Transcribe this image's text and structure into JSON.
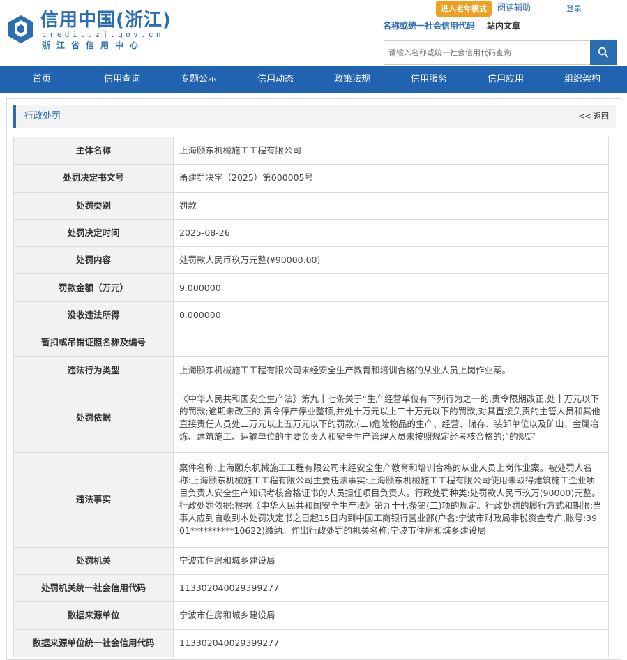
{
  "site": {
    "name": "信用中国(浙江)",
    "domain": "credit.zj.gov.cn",
    "center": "浙江省信用中心"
  },
  "topbar": {
    "elder_mode": "进入老年模式",
    "read_assist": "阅读辅助",
    "login": "登录"
  },
  "search": {
    "tab_active": "名称或统一社会信用代码",
    "tab_other": "站内文章",
    "placeholder": "请输入名称或统一社会信用代码查询",
    "icon": "search-icon"
  },
  "nav": [
    "首页",
    "信用查询",
    "专题公示",
    "信用动态",
    "政策法规",
    "信用服务",
    "信用应用",
    "组织架构"
  ],
  "panel": {
    "title": "行政处罚",
    "back": "<< 返回"
  },
  "rows": [
    {
      "label": "主体名称",
      "value": "上海颐东机械施工工程有限公司"
    },
    {
      "label": "处罚决定书文号",
      "value": "甬建罚决字（2025）第000005号"
    },
    {
      "label": "处罚类别",
      "value": "罚款"
    },
    {
      "label": "处罚决定时间",
      "value": "2025-08-26"
    },
    {
      "label": "处罚内容",
      "value": "处罚款人民币玖万元整(¥90000.00)"
    },
    {
      "label": "罚款金额（万元）",
      "value": "9.000000"
    },
    {
      "label": "没收违法所得",
      "value": "0.000000"
    },
    {
      "label": "暂扣或吊销证照名称及编号",
      "value": "-"
    },
    {
      "label": "违法行为类型",
      "value": "上海颐东机械施工工程有限公司未经安全生产教育和培训合格的从业人员上岗作业案。"
    },
    {
      "label": "处罚依据",
      "value": "《中华人民共和国安全生产法》第九十七条关于“生产经营单位有下列行为之一的,责令限期改正,处十万元以下的罚款;逾期未改正的,责令停产停业整顿,并处十万元以上二十万元以下的罚款,对其直接负责的主管人员和其他直接责任人员处二万元以上五万元以下的罚款:(二)危险物品的生产、经营、储存、装卸单位以及矿山、金属冶炼、建筑施工、运输单位的主要负责人和安全生产管理人员未按照规定经考核合格的;”的规定"
    },
    {
      "label": "违法事实",
      "value": "案件名称:上海颐东机械施工工程有限公司未经安全生产教育和培训合格的从业人员上岗作业案。被处罚人名称:上海颐东机械施工工程有限公司主要违法事实:上海颐东机械施工工程有限公司使用未取得建筑施工企业项目负责人安全生产知识考核合格证书的人员担任项目负责人。行政处罚种类:处罚款人民币玖万(90000)元整。行政处罚依据:根据《中华人民共和国安全生产法》第九十七条第(二)项的规定。行政处罚的履行方式和期限:当事人应到自收到本处罚决定书之日起15日内到中国工商银行营业部(户名:宁波市财政局非税资金专户,账号:3901**********10622)缴纳。作出行政处罚的机关名称:宁波市住房和城乡建设局"
    },
    {
      "label": "处罚机关",
      "value": "宁波市住房和城乡建设局"
    },
    {
      "label": "处罚机关统一社会信用代码",
      "value": "113302040029399277"
    },
    {
      "label": "数据来源单位",
      "value": "宁波市住房和城乡建设局"
    },
    {
      "label": "数据来源单位统一社会信用代码",
      "value": "113302040029399277"
    }
  ]
}
